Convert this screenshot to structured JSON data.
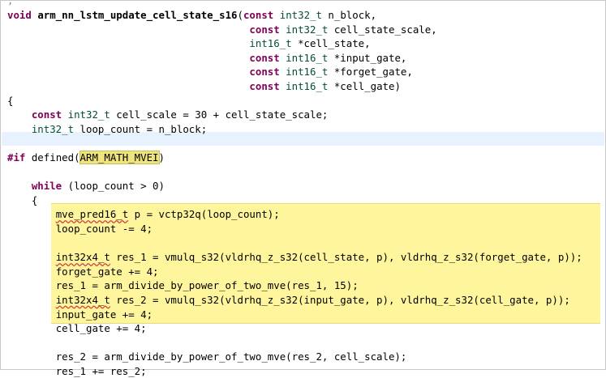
{
  "code_lines": [
    {
      "id": "l0",
      "parts": [
        {
          "t": "void ",
          "c": "kw"
        },
        {
          "t": "arm_nn_lstm_update_cell_state_s16",
          "c": "fn"
        },
        {
          "t": "(",
          "c": ""
        },
        {
          "t": "const ",
          "c": "kw"
        },
        {
          "t": "int32_t",
          "c": "ty"
        },
        {
          "t": " n_block,",
          "c": ""
        }
      ]
    },
    {
      "id": "l1",
      "indent": "                                        ",
      "parts": [
        {
          "t": "const ",
          "c": "kw"
        },
        {
          "t": "int32_t",
          "c": "ty"
        },
        {
          "t": " cell_state_scale,",
          "c": ""
        }
      ]
    },
    {
      "id": "l2",
      "indent": "                                        ",
      "parts": [
        {
          "t": "int16_t",
          "c": "ty"
        },
        {
          "t": " *cell_state,",
          "c": ""
        }
      ]
    },
    {
      "id": "l3",
      "indent": "                                        ",
      "parts": [
        {
          "t": "const ",
          "c": "kw"
        },
        {
          "t": "int16_t",
          "c": "ty"
        },
        {
          "t": " *input_gate,",
          "c": ""
        }
      ]
    },
    {
      "id": "l4",
      "indent": "                                        ",
      "parts": [
        {
          "t": "const ",
          "c": "kw"
        },
        {
          "t": "int16_t",
          "c": "ty"
        },
        {
          "t": " *forget_gate,",
          "c": ""
        }
      ]
    },
    {
      "id": "l5",
      "indent": "                                        ",
      "parts": [
        {
          "t": "const ",
          "c": "kw"
        },
        {
          "t": "int16_t",
          "c": "ty"
        },
        {
          "t": " *cell_gate)",
          "c": ""
        }
      ]
    },
    {
      "id": "l6",
      "parts": [
        {
          "t": "{",
          "c": ""
        }
      ]
    },
    {
      "id": "l7",
      "indent": "    ",
      "parts": [
        {
          "t": "const ",
          "c": "kw"
        },
        {
          "t": "int32_t",
          "c": "ty"
        },
        {
          "t": " cell_scale = 30 + cell_state_scale;",
          "c": ""
        }
      ]
    },
    {
      "id": "l8",
      "indent": "    ",
      "parts": [
        {
          "t": "int32_t",
          "c": "ty"
        },
        {
          "t": " loop_count = n_block;",
          "c": ""
        }
      ]
    },
    {
      "id": "l9",
      "parts": [
        {
          "t": "",
          "c": ""
        }
      ]
    },
    {
      "id": "l10",
      "parts": [
        {
          "t": "#if",
          "c": "pp"
        },
        {
          "t": " defined(",
          "c": ""
        },
        {
          "t": "ARM_MATH_MVEI",
          "c": "macro"
        },
        {
          "t": ")",
          "c": ""
        }
      ]
    },
    {
      "id": "l11",
      "parts": [
        {
          "t": "",
          "c": ""
        }
      ]
    },
    {
      "id": "l12",
      "indent": "    ",
      "parts": [
        {
          "t": "while",
          "c": "kw"
        },
        {
          "t": " (loop_count > 0)",
          "c": ""
        }
      ]
    },
    {
      "id": "l13",
      "indent": "    ",
      "parts": [
        {
          "t": "{",
          "c": ""
        }
      ]
    },
    {
      "id": "l14",
      "indent": "        ",
      "parts": [
        {
          "t": "mve_pred16_t",
          "c": "squig"
        },
        {
          "t": " p = vctp32q(loop_count);",
          "c": ""
        }
      ]
    },
    {
      "id": "l15",
      "indent": "        ",
      "parts": [
        {
          "t": "loop_count -= 4;",
          "c": ""
        }
      ]
    },
    {
      "id": "l16",
      "parts": [
        {
          "t": "",
          "c": ""
        }
      ]
    },
    {
      "id": "l17",
      "indent": "        ",
      "parts": [
        {
          "t": "int32x4_t",
          "c": "squig"
        },
        {
          "t": " res_1 = vmulq_s32(vldrhq_z_s32(cell_state, p), vldrhq_z_s32(forget_gate, p));",
          "c": ""
        }
      ]
    },
    {
      "id": "l18",
      "indent": "        ",
      "parts": [
        {
          "t": "forget_gate += 4;",
          "c": ""
        }
      ]
    },
    {
      "id": "l19",
      "indent": "        ",
      "parts": [
        {
          "t": "res_1 = arm_divide_by_power_of_two_mve(res_1, 15);",
          "c": ""
        }
      ]
    },
    {
      "id": "l20",
      "indent": "        ",
      "parts": [
        {
          "t": "int32x4_t",
          "c": "squig"
        },
        {
          "t": " res_2 = vmulq_s32(vldrhq_z_s32(input_gate, p), vldrhq_z_s32(cell_gate, p));",
          "c": ""
        }
      ]
    },
    {
      "id": "l21",
      "indent": "        ",
      "parts": [
        {
          "t": "input_gate += 4;",
          "c": ""
        }
      ]
    },
    {
      "id": "l22",
      "indent": "        ",
      "parts": [
        {
          "t": "cell_gate += 4;",
          "c": ""
        }
      ]
    },
    {
      "id": "l23",
      "parts": [
        {
          "t": "",
          "c": ""
        }
      ]
    },
    {
      "id": "l24",
      "indent": "        ",
      "parts": [
        {
          "t": "res_2 = arm_divide_by_power_of_two_mve(res_2, cell_scale);",
          "c": ""
        }
      ]
    },
    {
      "id": "l25",
      "indent": "        ",
      "parts": [
        {
          "t": "res_1 += res_2;",
          "c": ""
        }
      ]
    }
  ],
  "colors": {
    "keyword": "#7f0055",
    "type": "#005032",
    "selection_highlight": "#fff59d",
    "macro_highlight": "#eee47e",
    "current_line": "#e8f2fe"
  }
}
